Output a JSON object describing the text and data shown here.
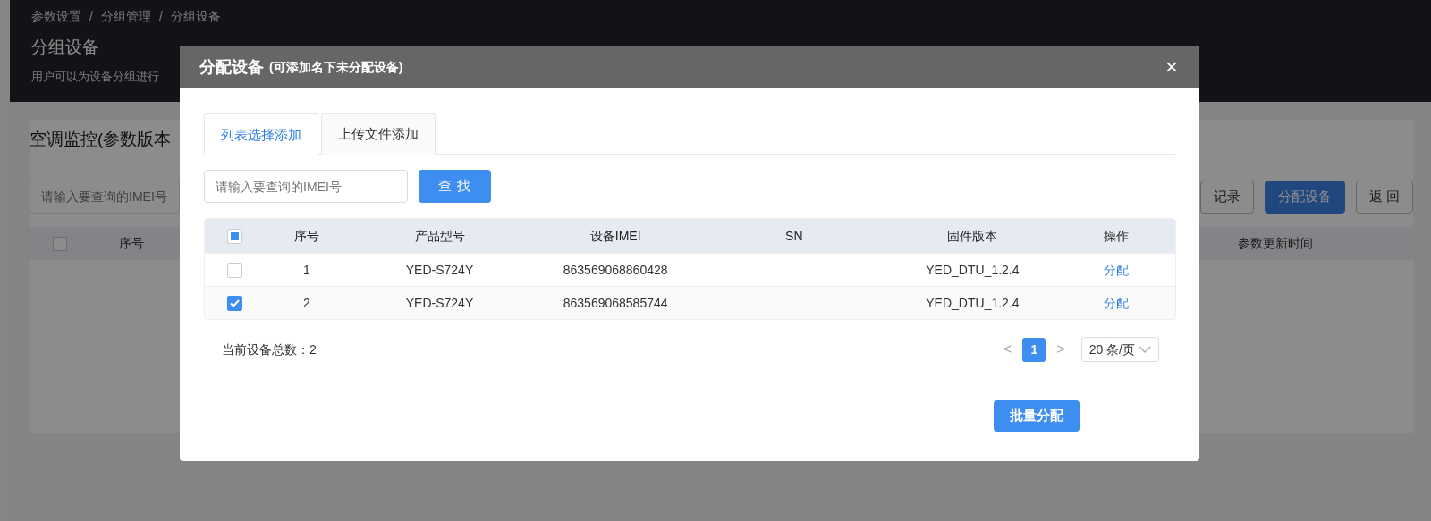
{
  "page": {
    "breadcrumb": [
      "参数设置",
      "分组管理",
      "分组设备"
    ],
    "breadcrumb_separator": "/",
    "title": "分组设备",
    "description": "用户可以为设备分组进行",
    "section_title": "空调监控(参数版本",
    "search": {
      "placeholder": "请输入要查询的IMEI号"
    },
    "buttons": [
      {
        "label": "记录",
        "kind": "outline"
      },
      {
        "label": "分配设备",
        "kind": "primary"
      },
      {
        "label": "返 回",
        "kind": "outline"
      }
    ],
    "table": {
      "select_all_checked": false,
      "columns": [
        "序号",
        "参数更新时间"
      ]
    }
  },
  "modal": {
    "title": "分配设备",
    "subtitle": "(可添加名下未分配设备)",
    "close": "×",
    "tabs": [
      {
        "label": "列表选择添加",
        "selected": true
      },
      {
        "label": "上传文件添加",
        "selected": false
      }
    ],
    "search": {
      "placeholder": "请输入要查询的IMEI号",
      "button": "查 找"
    },
    "table": {
      "header_checkbox_indeterminate": true,
      "columns": [
        "序号",
        "产品型号",
        "设备IMEI",
        "SN",
        "固件版本",
        "操作"
      ],
      "rows": [
        {
          "checked": false,
          "index": "1",
          "model": "YED-S724Y",
          "imei": "863569068860428",
          "firmware": "YED_DTU_1.2.4",
          "action": "分配"
        },
        {
          "checked": true,
          "index": "2",
          "model": "YED-S724Y",
          "imei": "863569068585744",
          "firmware": "YED_DTU_1.2.4",
          "action": "分配"
        }
      ]
    },
    "total": "当前设备总数：2",
    "pagination": {
      "prev": "<",
      "pages": [
        {
          "label": "1",
          "selected": true
        }
      ],
      "next": ">",
      "page_size": "20 条/页"
    },
    "submit": "批量分配"
  }
}
